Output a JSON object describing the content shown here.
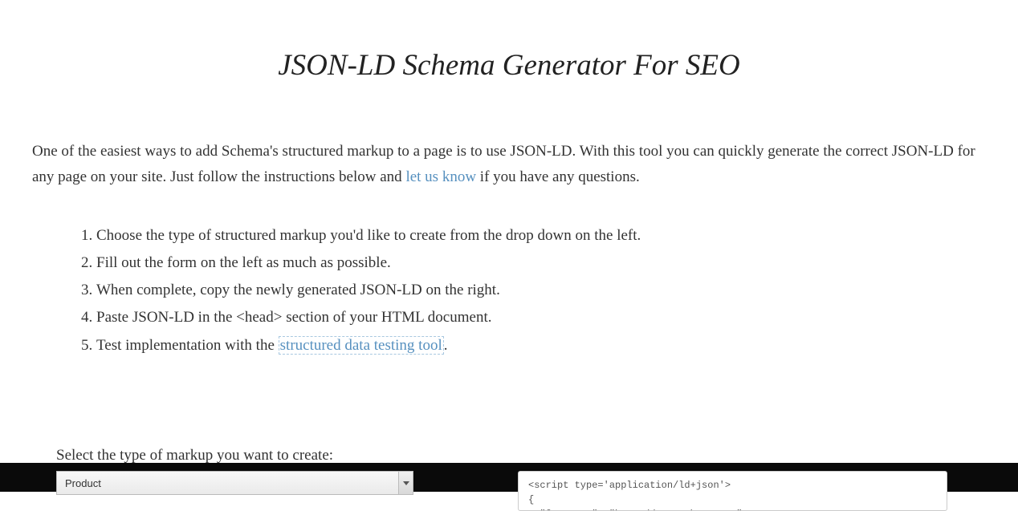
{
  "page": {
    "title": "JSON-LD Schema Generator For SEO",
    "intro_before_link": "One of the easiest ways to add Schema's structured markup to a page is to use JSON-LD. With this tool you can quickly generate the correct JSON-LD for any page on your site. Just follow the instructions below and ",
    "intro_link": "let us know",
    "intro_after_link": " if you have any questions."
  },
  "steps": {
    "s1": "Choose the type of structured markup you'd like to create from the drop down on the left.",
    "s2": "Fill out the form on the left as much as possible.",
    "s3": "When complete, copy the newly generated JSON-LD on the right.",
    "s4": "Paste JSON-LD in the <head> section of your HTML document.",
    "s5_before": "Test implementation with the ",
    "s5_link": "structured data testing tool",
    "s5_after": "."
  },
  "form": {
    "select_label": "Select the type of markup you want to create:",
    "selected_option": "Product"
  },
  "output": {
    "code": "<script type='application/ld+json'>\n{\n  \"@context\": \"http://www.schema.org\","
  }
}
